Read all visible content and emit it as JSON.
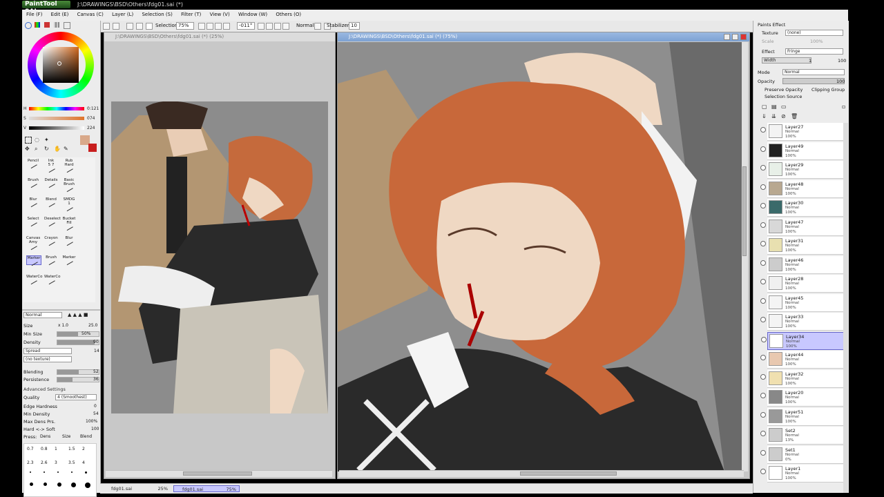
{
  "app": {
    "logo": "PaintTool SAI",
    "title": "J:\\DRAWINGS\\BSD\\Others\\fdg01.sai (*)"
  },
  "menu": [
    "File (F)",
    "Edit (E)",
    "Canvas (C)",
    "Layer (L)",
    "Selection (S)",
    "Filter (T)",
    "View (V)",
    "Window (W)",
    "Others (O)"
  ],
  "toolbar": {
    "selection_label": "Selection",
    "zoom": "75%",
    "rotation": "-011°",
    "blend": "Normal",
    "stabilizer_label": "Stabilizer",
    "stabilizer_value": "10"
  },
  "color": {
    "h_label": "H",
    "h_value": "0:121",
    "s_label": "S",
    "s_value": "074",
    "v_label": "V",
    "v_value": "224",
    "primary": "#d9a98a",
    "secondary": "#c81e1e"
  },
  "tools": [
    "Pencil",
    "Ink",
    "Rub",
    "Brush",
    "Details",
    "Basic",
    "Blur",
    "Blend",
    "SMDG 1",
    "Select",
    "Deselect",
    "Bucket",
    "Canvas",
    "Crayon",
    "Blur",
    "Marker",
    "Brush",
    "Marker",
    "WaterCo",
    "WaterCo"
  ],
  "tool_sub": [
    "",
    "5 7",
    "Hard",
    "",
    "",
    "Brush",
    "",
    "",
    "",
    "",
    "",
    "Fill",
    "Amy",
    "",
    "",
    "",
    "",
    "",
    "",
    ""
  ],
  "brush": {
    "mode": "Normal",
    "size_label": "Size",
    "size_mult": "x 1.0",
    "size_value": "25.0",
    "min_size_label": "Min Size",
    "min_size_value": "50%",
    "min_size_frac": 0.5,
    "density_label": "Density",
    "density_value": "90",
    "density_frac": 0.9,
    "spread_label": "Spread",
    "spread_value": "14",
    "texture": "(no texture)",
    "blending_label": "Blending",
    "blending_value": "52",
    "blending_frac": 0.52,
    "persistence_label": "Persistence",
    "persistence_value": "36",
    "persistence_frac": 0.36,
    "advanced_label": "Advanced Settings",
    "quality_label": "Quality",
    "quality_value": "4 (Smoothest)",
    "edge_label": "Edge Hardness",
    "edge_value": "0",
    "min_density_label": "Min Density",
    "min_density_value": "54",
    "max_dens_label": "Max Dens Prs.",
    "max_dens_value": "100%",
    "hard_soft_label": "Hard <-> Soft",
    "hard_soft_value": "100",
    "press_label": "Press:",
    "press_dens": "Dens",
    "press_size": "Size",
    "press_blend": "Blend",
    "sizes_row1": [
      "0.7",
      "0.8",
      "1",
      "1.5",
      "2"
    ],
    "sizes_row2": [
      "2.3",
      "2.6",
      "3",
      "3.5",
      "4"
    ]
  },
  "canvases": [
    {
      "title": "J:\\DRAWINGS\\BSD\\Others\\fdg01.sai (*) (25%)"
    },
    {
      "title": "J:\\DRAWINGS\\BSD\\Others\\fdg01.sai (*) (75%)"
    }
  ],
  "paper": {
    "title": "Paints Effect",
    "texture_label": "Texture",
    "texture_value": "(none)",
    "scale_label": "Scale",
    "scale_value": "100%",
    "effect_label": "Effect",
    "effect_value": "Fringe",
    "width_label": "Width",
    "width_value": "1",
    "width_max": "100",
    "mode_label": "Mode",
    "mode_value": "Normal",
    "opacity_label": "Opacity",
    "opacity_value": "100",
    "preserve_label": "Preserve Opacity",
    "clipping_label": "Clipping Group",
    "selection_source_label": "Selection Source"
  },
  "layers": [
    {
      "name": "Layer27",
      "mode": "Normal",
      "opacity": "100%",
      "color": "#f3f3f3"
    },
    {
      "name": "Layer49",
      "mode": "Normal",
      "opacity": "100%",
      "color": "#222222"
    },
    {
      "name": "Layer29",
      "mode": "Normal",
      "opacity": "100%",
      "color": "#e8f0e8"
    },
    {
      "name": "Layer48",
      "mode": "Normal",
      "opacity": "100%",
      "color": "#b8a890"
    },
    {
      "name": "Layer30",
      "mode": "Normal",
      "opacity": "100%",
      "color": "#3a6a6a"
    },
    {
      "name": "Layer47",
      "mode": "Normal",
      "opacity": "100%",
      "color": "#d8d8d8"
    },
    {
      "name": "Layer31",
      "mode": "Normal",
      "opacity": "100%",
      "color": "#e8e0b0"
    },
    {
      "name": "Layer46",
      "mode": "Normal",
      "opacity": "100%",
      "color": "#cccccc"
    },
    {
      "name": "Layer28",
      "mode": "Normal",
      "opacity": "100%",
      "color": "#f0f0f0"
    },
    {
      "name": "Layer45",
      "mode": "Normal",
      "opacity": "100%",
      "color": "#f4f4f4"
    },
    {
      "name": "Layer33",
      "mode": "Normal",
      "opacity": "100%",
      "color": "#f4f4f4"
    },
    {
      "name": "Layer34",
      "mode": "Normal",
      "opacity": "100%",
      "color": "#ffffff",
      "selected": true
    },
    {
      "name": "Layer44",
      "mode": "Normal",
      "opacity": "100%",
      "color": "#e8c8b0"
    },
    {
      "name": "Layer32",
      "mode": "Normal",
      "opacity": "100%",
      "color": "#f0e0b0"
    },
    {
      "name": "Layer20",
      "mode": "Normal",
      "opacity": "100%",
      "color": "#888888"
    },
    {
      "name": "Layer51",
      "mode": "Normal",
      "opacity": "100%",
      "color": "#999999"
    },
    {
      "name": "Set2",
      "mode": "Normal",
      "opacity": "13%",
      "color": "#cccccc",
      "folder": true
    },
    {
      "name": "Set1",
      "mode": "Normal",
      "opacity": "0%",
      "color": "#cccccc",
      "folder": true
    },
    {
      "name": "Layer1",
      "mode": "Normal",
      "opacity": "100%",
      "color": "#ffffff"
    }
  ],
  "tabs": [
    {
      "name": "fdg01.sai",
      "zoom": "25%"
    },
    {
      "name": "fdg01.sai",
      "zoom": "75%"
    }
  ]
}
